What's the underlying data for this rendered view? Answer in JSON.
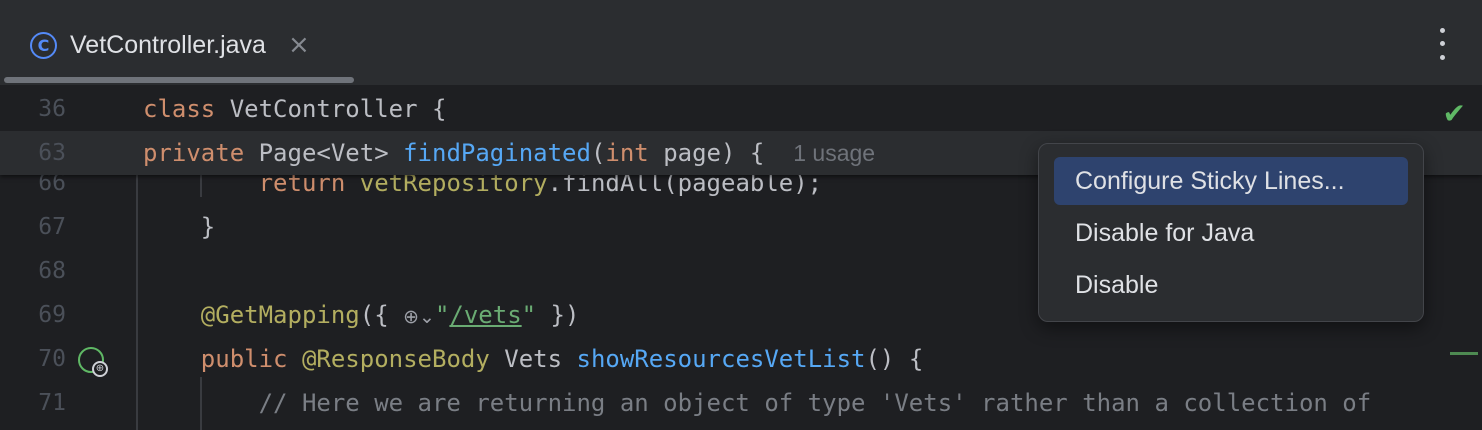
{
  "tab": {
    "icon": "class-icon",
    "icon_glyph": "C",
    "title": "VetController.java",
    "close": "×"
  },
  "sticky_lines": [
    {
      "number": "36",
      "parts": [
        [
          "kw",
          "class "
        ],
        [
          "",
          "VetController {"
        ]
      ]
    },
    {
      "number": "63",
      "parts": [
        [
          "kw",
          "private "
        ],
        [
          "",
          "Page<Vet> "
        ],
        [
          "fn",
          "findPaginated"
        ],
        [
          "",
          "("
        ],
        [
          "kw",
          "int "
        ],
        [
          "",
          "page) {  "
        ]
      ],
      "hint": "1 usage"
    }
  ],
  "lines": [
    {
      "number": "66",
      "parts": [
        [
          "",
          "        "
        ],
        [
          "kw",
          "return "
        ],
        [
          "an",
          "vetRepository"
        ],
        [
          "",
          "."
        ],
        [
          "",
          "findAll(pageable);"
        ]
      ]
    },
    {
      "number": "67",
      "parts": [
        [
          "",
          "    }"
        ]
      ]
    },
    {
      "number": "68",
      "parts": [
        [
          "",
          ""
        ]
      ]
    },
    {
      "number": "69",
      "parts": [
        [
          "",
          "    "
        ],
        [
          "an",
          "@GetMapping"
        ],
        [
          "",
          "({ "
        ],
        [
          "globe",
          ""
        ],
        [
          "str",
          "\""
        ],
        [
          "str",
          "/vets"
        ],
        [
          "str",
          "\""
        ],
        [
          "",
          " })"
        ]
      ]
    },
    {
      "number": "70",
      "parts": [
        [
          "",
          "    "
        ],
        [
          "kw",
          "public "
        ],
        [
          "an",
          "@ResponseBody "
        ],
        [
          "",
          "Vets "
        ],
        [
          "fn",
          "showResourcesVetList"
        ],
        [
          "",
          "() {"
        ]
      ]
    },
    {
      "number": "71",
      "parts": [
        [
          "",
          "        "
        ],
        [
          "cm",
          "// Here we are returning an object of type 'Vets' rather than a collection of"
        ]
      ]
    }
  ],
  "popup_menu": {
    "items": [
      {
        "label": "Configure Sticky Lines...",
        "selected": true
      },
      {
        "label": "Disable for Java",
        "selected": false
      },
      {
        "label": "Disable",
        "selected": false
      }
    ]
  },
  "status": {
    "inspection_icon": "check-icon",
    "inspection_glyph": "✔"
  },
  "gutter": {
    "line_70_icon": "endpoint-globe-icon"
  },
  "colors": {
    "keyword": "#cf8e6d",
    "function": "#56a8f5",
    "annotation": "#b3ae60",
    "string": "#6aab73",
    "comment": "#7a7e85",
    "selection": "#2e436e"
  }
}
